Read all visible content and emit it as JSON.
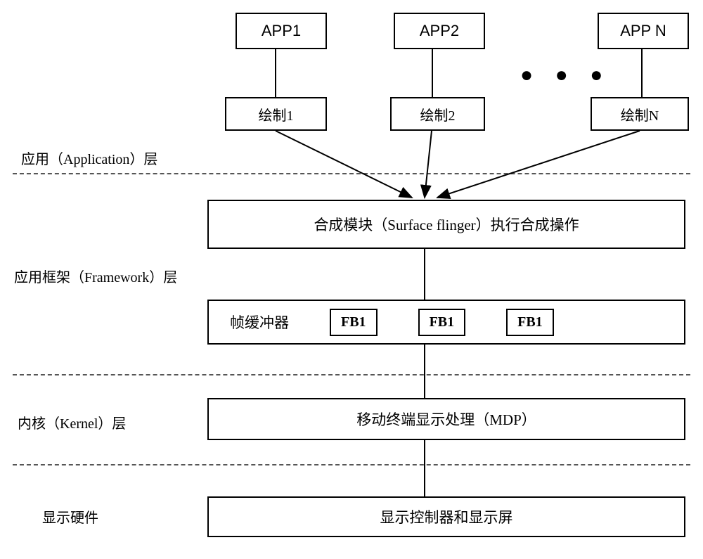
{
  "apps": {
    "app1": "APP1",
    "app2": "APP2",
    "appn": "APP N"
  },
  "draw": {
    "draw1": "绘制1",
    "draw2": "绘制2",
    "drawn": "绘制N"
  },
  "ellipsis": "● ● ●",
  "layers": {
    "application": "应用（Application）层",
    "framework": "应用框架（Framework）层",
    "kernel": "内核（Kernel）层",
    "hardware": "显示硬件"
  },
  "compositor": "合成模块（Surface flinger）执行合成操作",
  "framebuffer": {
    "label": "帧缓冲器",
    "fb1": "FB1",
    "fb2": "FB1",
    "fb3": "FB1"
  },
  "mdp": "移动终端显示处理（MDP）",
  "display": "显示控制器和显示屏"
}
